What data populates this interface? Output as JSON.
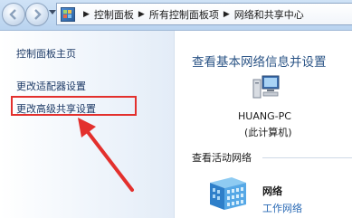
{
  "address_bar": {
    "crumbs": [
      "控制面板",
      "所有控制面板项",
      "网络和共享中心"
    ]
  },
  "sidebar": {
    "home_link": "控制面板主页",
    "adapter_link": "更改适配器设置",
    "sharing_link": "更改高级共享设置"
  },
  "main": {
    "title": "查看基本网络信息并设置",
    "computer_name": "HUANG-PC",
    "computer_sub": "(此计算机)",
    "active_networks_label": "查看活动网络",
    "network_name": "网络",
    "network_type": "工作网络"
  },
  "colors": {
    "highlight": "#e3302d",
    "link": "#1d3a66",
    "title": "#2b5486"
  },
  "icons": {
    "back": "back-arrow-icon",
    "forward": "forward-arrow-icon",
    "control_panel": "control-panel-icon",
    "computer": "computer-icon",
    "network": "network-building-icon"
  }
}
